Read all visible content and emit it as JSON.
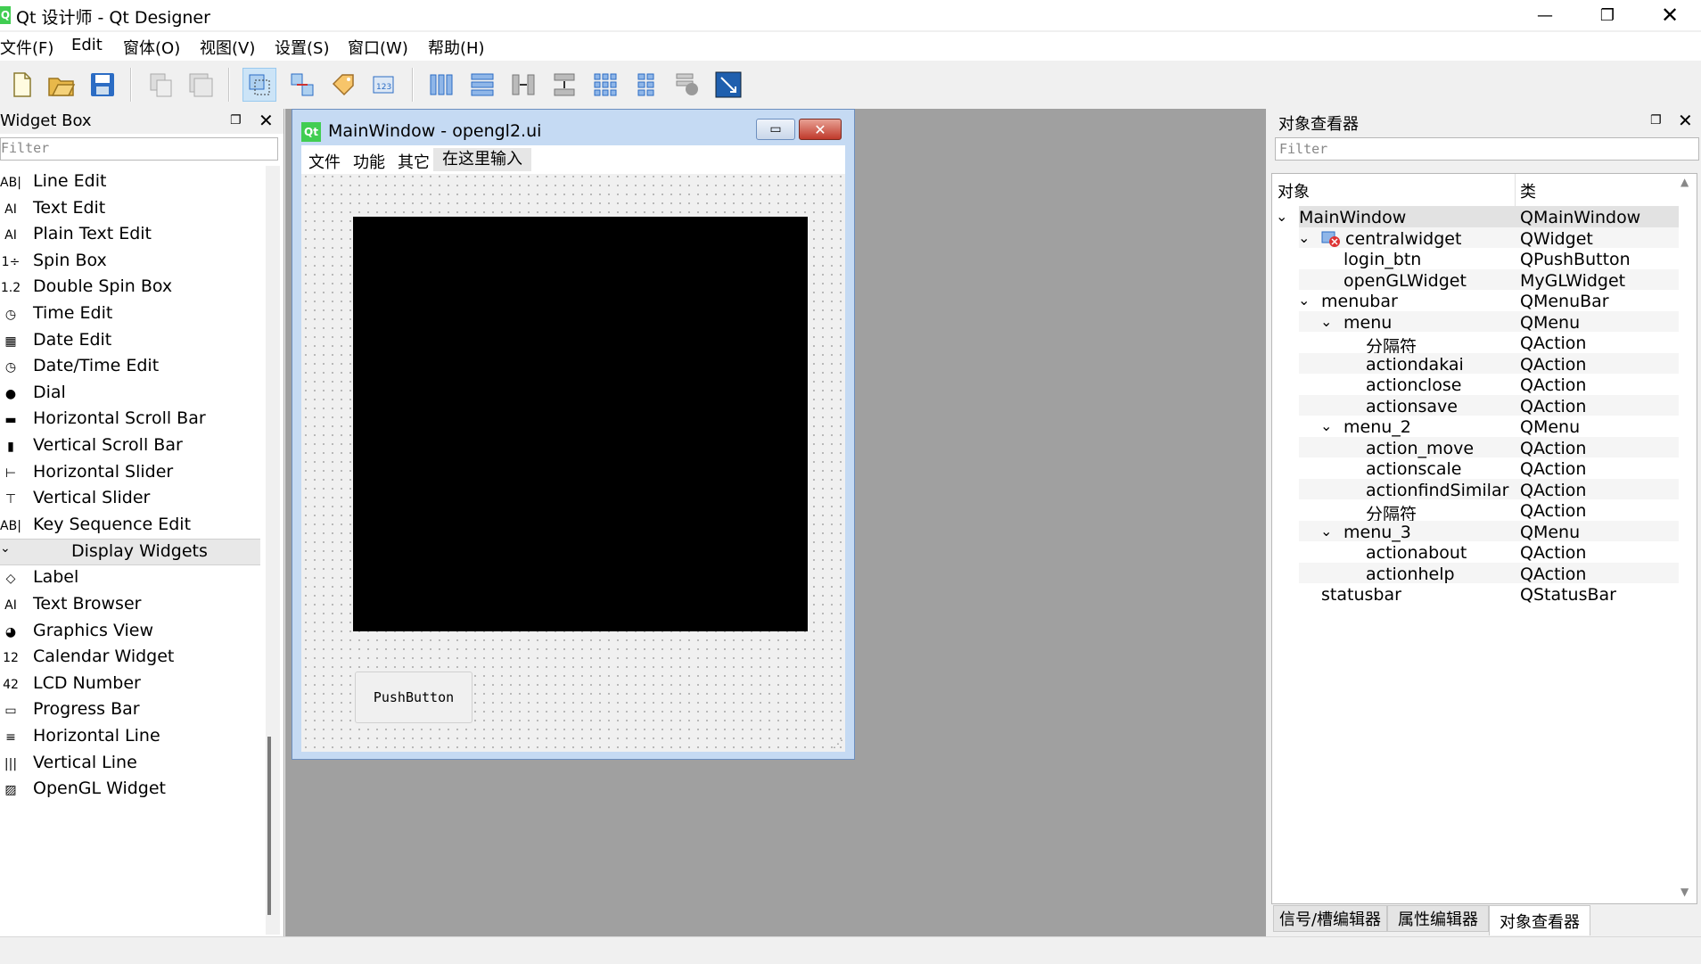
{
  "window": {
    "title": "Qt 设计师 - Qt Designer",
    "app_icon": "qt-logo-icon"
  },
  "menubar": {
    "items": [
      "文件(F)",
      "Edit",
      "窗体(O)",
      "视图(V)",
      "设置(S)",
      "窗口(W)",
      "帮助(H)"
    ]
  },
  "toolbar": {
    "icons": [
      "new-file-icon",
      "open-folder-icon",
      "save-icon",
      "copy-icon",
      "paste-icon",
      "edit-widgets-icon",
      "edit-signals-slots-icon",
      "edit-buddies-icon",
      "edit-tab-order-icon",
      "layout-horizontal-icon",
      "layout-vertical-icon",
      "splitter-horizontal-icon",
      "splitter-vertical-icon",
      "layout-grid-icon",
      "layout-form-icon",
      "break-layout-icon",
      "adjust-size-icon"
    ]
  },
  "widget_box": {
    "title": "Widget Box",
    "filter_placeholder": "Filter",
    "items": [
      {
        "label": "Line Edit",
        "icon": "line-edit-icon"
      },
      {
        "label": "Text Edit",
        "icon": "text-edit-icon"
      },
      {
        "label": "Plain Text Edit",
        "icon": "plain-text-edit-icon"
      },
      {
        "label": "Spin Box",
        "icon": "spin-box-icon"
      },
      {
        "label": "Double Spin Box",
        "icon": "double-spin-box-icon"
      },
      {
        "label": "Time Edit",
        "icon": "time-edit-icon"
      },
      {
        "label": "Date Edit",
        "icon": "date-edit-icon"
      },
      {
        "label": "Date/Time Edit",
        "icon": "datetime-edit-icon"
      },
      {
        "label": "Dial",
        "icon": "dial-icon"
      },
      {
        "label": "Horizontal Scroll Bar",
        "icon": "hscrollbar-icon"
      },
      {
        "label": "Vertical Scroll Bar",
        "icon": "vscrollbar-icon"
      },
      {
        "label": "Horizontal Slider",
        "icon": "hslider-icon"
      },
      {
        "label": "Vertical Slider",
        "icon": "vslider-icon"
      },
      {
        "label": "Key Sequence Edit",
        "icon": "key-sequence-icon"
      }
    ],
    "category": "Display Widgets",
    "display_items": [
      {
        "label": "Label",
        "icon": "label-icon"
      },
      {
        "label": "Text Browser",
        "icon": "text-browser-icon"
      },
      {
        "label": "Graphics View",
        "icon": "graphics-view-icon"
      },
      {
        "label": "Calendar Widget",
        "icon": "calendar-icon"
      },
      {
        "label": "LCD Number",
        "icon": "lcd-number-icon"
      },
      {
        "label": "Progress Bar",
        "icon": "progress-bar-icon"
      },
      {
        "label": "Horizontal Line",
        "icon": "hline-icon"
      },
      {
        "label": "Vertical Line",
        "icon": "vline-icon"
      },
      {
        "label": "OpenGL Widget",
        "icon": "opengl-icon"
      }
    ]
  },
  "form": {
    "title": "MainWindow - opengl2.ui",
    "menus": [
      "文件",
      "功能",
      "其它",
      "在这里输入"
    ],
    "push_button": "PushButton",
    "close_glyph": "✕",
    "min_glyph": "▭"
  },
  "object_inspector": {
    "title": "对象查看器",
    "filter_placeholder": "Filter",
    "col_object": "对象",
    "col_class": "类",
    "rows": [
      {
        "name": "MainWindow",
        "class": "QMainWindow",
        "level": 0,
        "expanded": true
      },
      {
        "name": "centralwidget",
        "class": "QWidget",
        "level": 1,
        "expanded": true,
        "icon": "layout-broken-icon"
      },
      {
        "name": "login_btn",
        "class": "QPushButton",
        "level": 2
      },
      {
        "name": "openGLWidget",
        "class": "MyGLWidget",
        "level": 2
      },
      {
        "name": "menubar",
        "class": "QMenuBar",
        "level": 1,
        "expanded": true
      },
      {
        "name": "menu",
        "class": "QMenu",
        "level": 2,
        "expanded": true
      },
      {
        "name": "分隔符",
        "class": "QAction",
        "level": 3
      },
      {
        "name": "actiondakai",
        "class": "QAction",
        "level": 3
      },
      {
        "name": "actionclose",
        "class": "QAction",
        "level": 3
      },
      {
        "name": "actionsave",
        "class": "QAction",
        "level": 3
      },
      {
        "name": "menu_2",
        "class": "QMenu",
        "level": 2,
        "expanded": true
      },
      {
        "name": "action_move",
        "class": "QAction",
        "level": 3
      },
      {
        "name": "actionscale",
        "class": "QAction",
        "level": 3
      },
      {
        "name": "actionfindSimilar",
        "class": "QAction",
        "level": 3
      },
      {
        "name": "分隔符",
        "class": "QAction",
        "level": 3
      },
      {
        "name": "menu_3",
        "class": "QMenu",
        "level": 2,
        "expanded": true
      },
      {
        "name": "actionabout",
        "class": "QAction",
        "level": 3
      },
      {
        "name": "actionhelp",
        "class": "QAction",
        "level": 3
      },
      {
        "name": "statusbar",
        "class": "QStatusBar",
        "level": 1
      }
    ],
    "tabs": [
      "信号/槽编辑器",
      "属性编辑器",
      "对象查看器"
    ]
  },
  "colors": {
    "form_frame": "#c5daf3",
    "mdi_background": "#a0a0a0",
    "gl_widget": "#000000",
    "selected_row": "#e2e2e2"
  }
}
